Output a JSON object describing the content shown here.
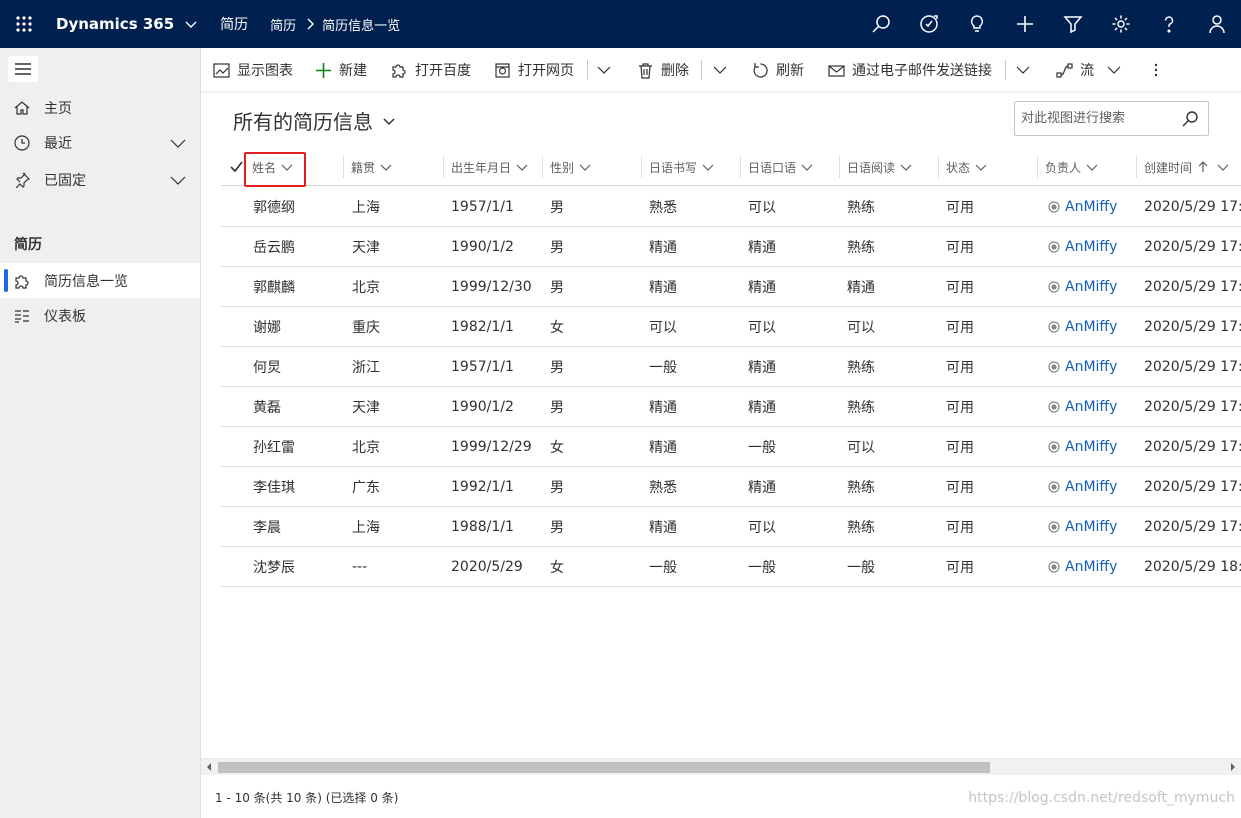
{
  "topbar": {
    "app_name": "Dynamics 365",
    "area": "简历",
    "breadcrumb": [
      "简历",
      "简历信息一览"
    ]
  },
  "sidebar": {
    "items": [
      {
        "label": "主页"
      },
      {
        "label": "最近"
      },
      {
        "label": "已固定"
      }
    ],
    "group": "简历",
    "entities": [
      {
        "label": "简历信息一览"
      },
      {
        "label": "仪表板"
      }
    ]
  },
  "commands": {
    "show_chart": "显示图表",
    "new": "新建",
    "open_baidu": "打开百度",
    "open_web": "打开网页",
    "delete": "删除",
    "refresh": "刷新",
    "email_link": "通过电子邮件发送链接",
    "flow": "流"
  },
  "view": {
    "title": "所有的简历信息",
    "search_placeholder": "对此视图进行搜索"
  },
  "grid": {
    "columns": [
      "姓名",
      "籍贯",
      "出生年月日",
      "性别",
      "日语书写",
      "日语口语",
      "日语阅读",
      "状态",
      "负责人",
      "创建时间"
    ],
    "rows": [
      [
        "郭德纲",
        "上海",
        "1957/1/1",
        "男",
        "熟悉",
        "可以",
        "熟练",
        "可用",
        "AnMiffy",
        "2020/5/29 17:..."
      ],
      [
        "岳云鹏",
        "天津",
        "1990/1/2",
        "男",
        "精通",
        "精通",
        "熟练",
        "可用",
        "AnMiffy",
        "2020/5/29 17:..."
      ],
      [
        "郭麒麟",
        "北京",
        "1999/12/30",
        "男",
        "精通",
        "精通",
        "精通",
        "可用",
        "AnMiffy",
        "2020/5/29 17:..."
      ],
      [
        "谢娜",
        "重庆",
        "1982/1/1",
        "女",
        "可以",
        "可以",
        "可以",
        "可用",
        "AnMiffy",
        "2020/5/29 17:..."
      ],
      [
        "何炅",
        "浙江",
        "1957/1/1",
        "男",
        "一般",
        "精通",
        "熟练",
        "可用",
        "AnMiffy",
        "2020/5/29 17:..."
      ],
      [
        "黄磊",
        "天津",
        "1990/1/2",
        "男",
        "精通",
        "精通",
        "熟练",
        "可用",
        "AnMiffy",
        "2020/5/29 17:..."
      ],
      [
        "孙红雷",
        "北京",
        "1999/12/29",
        "女",
        "精通",
        "一般",
        "可以",
        "可用",
        "AnMiffy",
        "2020/5/29 17:..."
      ],
      [
        "李佳琪",
        "广东",
        "1992/1/1",
        "男",
        "熟悉",
        "精通",
        "熟练",
        "可用",
        "AnMiffy",
        "2020/5/29 17:..."
      ],
      [
        "李晨",
        "上海",
        "1988/1/1",
        "男",
        "精通",
        "可以",
        "熟练",
        "可用",
        "AnMiffy",
        "2020/5/29 17:..."
      ],
      [
        "沈梦辰",
        "---",
        "2020/5/29",
        "女",
        "一般",
        "一般",
        "一般",
        "可用",
        "AnMiffy",
        "2020/5/29 18:..."
      ]
    ]
  },
  "footer": {
    "status": "1 - 10 条(共 10 条) (已选择 0 条)",
    "watermark": "https://blog.csdn.net/redsoft_mymuch"
  }
}
